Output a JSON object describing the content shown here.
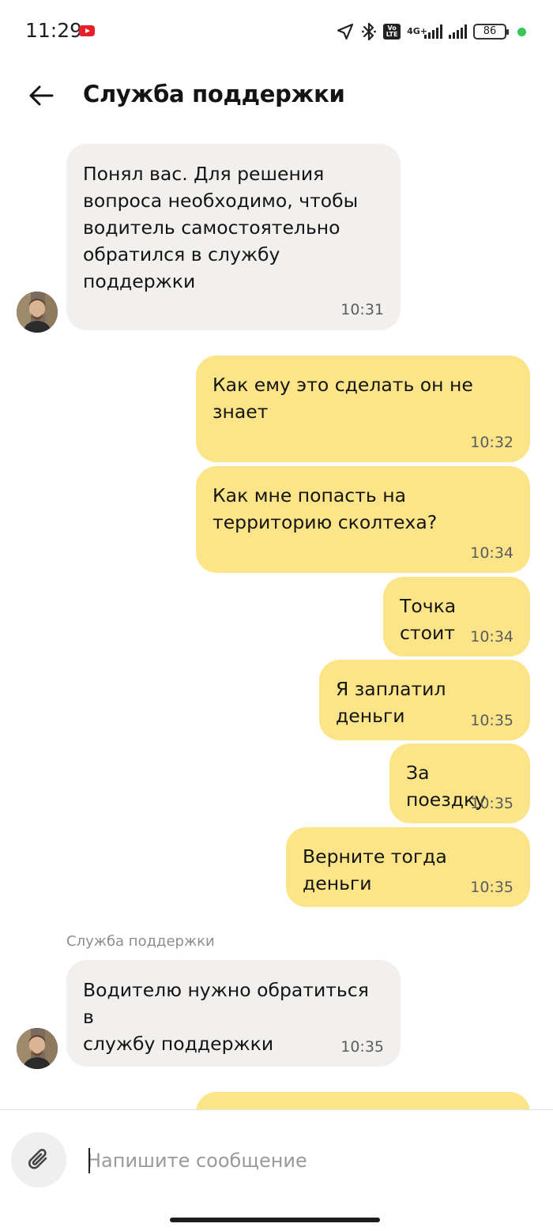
{
  "status_bar": {
    "time": "11:29",
    "battery": "86",
    "network": "4G+",
    "volte": "Vo LTE",
    "icons": [
      "youtube-notification-icon",
      "location-arrow-icon",
      "bluetooth-icon",
      "volte-icon",
      "signal-icon",
      "battery-icon"
    ]
  },
  "header": {
    "title": "Служба поддержки",
    "back_icon": "arrow-left-icon"
  },
  "messages": [
    {
      "direction": "incoming",
      "text": "Понял вас. Для решения\nвопроса необходимо, чтобы\nводитель самостоятельно\nобратился в службу\nподдержки",
      "time": "10:31"
    },
    {
      "direction": "outgoing",
      "text": "Как ему это сделать он не\nзнает",
      "time": "10:32"
    },
    {
      "direction": "outgoing",
      "text": "Как мне попасть на\nтерриторию сколтеха?",
      "time": "10:34"
    },
    {
      "direction": "outgoing",
      "text": "Точка стоит",
      "time": "10:34"
    },
    {
      "direction": "outgoing",
      "text": "Я заплатил деньги",
      "time": "10:35"
    },
    {
      "direction": "outgoing",
      "text": "За поездку",
      "time": "10:35"
    },
    {
      "direction": "outgoing",
      "text": "Верните тогда деньги",
      "time": "10:35"
    },
    {
      "direction": "incoming",
      "sender": "Служба поддержки",
      "text": "Водителю нужно обратиться в\nслужбу поддержки",
      "time": "10:35"
    }
  ],
  "composer": {
    "placeholder": "Напишите сообщение",
    "attach_icon": "paperclip-icon"
  },
  "colors": {
    "outgoing_bubble": "#fce588",
    "incoming_bubble": "#f1f0ee",
    "background": "#ffffff"
  }
}
